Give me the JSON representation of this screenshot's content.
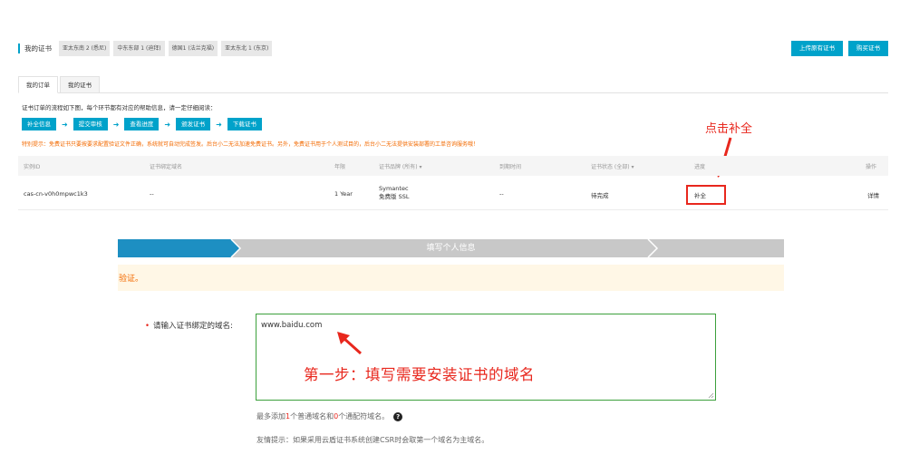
{
  "header": {
    "title": "我的证书",
    "regions": [
      "亚太东南 2 (悉尼)",
      "中东东部 1 (迪拜)",
      "德国1 (法兰克福)",
      "亚太东北 1 (东京)"
    ],
    "upload_label": "上传原有证书",
    "buy_label": "购买证书"
  },
  "tabs": [
    "我的订单",
    "我的证书"
  ],
  "intro": "证书订单的流程如下图，每个环节都有对应的帮助信息，请一定仔细阅读：",
  "steps": [
    "补全信息",
    "提交审核",
    "查看进度",
    "颁发证书",
    "下载证书"
  ],
  "tip": "特别提示：免费证书只要按要求配置验证文件正确，系统就可自动完成签发。后台小二无法加速免费证书。另外，免费证书用于个人测试目的，后台小二无法提供安装部署的工单咨询服务哦！",
  "callout_top": "点击补全",
  "table": {
    "headers": [
      "实例ID",
      "证书绑定域名",
      "年限",
      "证书品牌 (所有) ▾",
      "到期时间",
      "证书状态 (全部) ▾",
      "进度",
      "操作"
    ],
    "row": {
      "id": "cas-cn-v0h0mpwc1k3",
      "domain": "--",
      "years": "1 Year",
      "brand_line1": "Symantec",
      "brand_line2": "免费版 SSL",
      "expiry": "--",
      "status": "待完成",
      "progress": "补全",
      "action": "详情"
    }
  },
  "progress_step": "填写个人信息",
  "notice": "验证。",
  "form": {
    "required_mark": "•",
    "label": "请输入证书绑定的域名:",
    "domain_value": "www.baidu.com"
  },
  "callout_form": "第一步：填写需要安装证书的域名",
  "hint1": {
    "p1": "最多添加 ",
    "n1": "1",
    "p2": "个普通域名和 ",
    "n2": "0",
    "p3": "个通配符域名。",
    "help": "?"
  },
  "hint2": "友情提示：如果采用云盾证书系统创建CSR时会取第一个域名为主域名。",
  "colors": {
    "accent": "#00a2ca",
    "annotation_red": "#e8271d",
    "tip_orange": "#f36a00",
    "link_blue": "#0070cc"
  }
}
